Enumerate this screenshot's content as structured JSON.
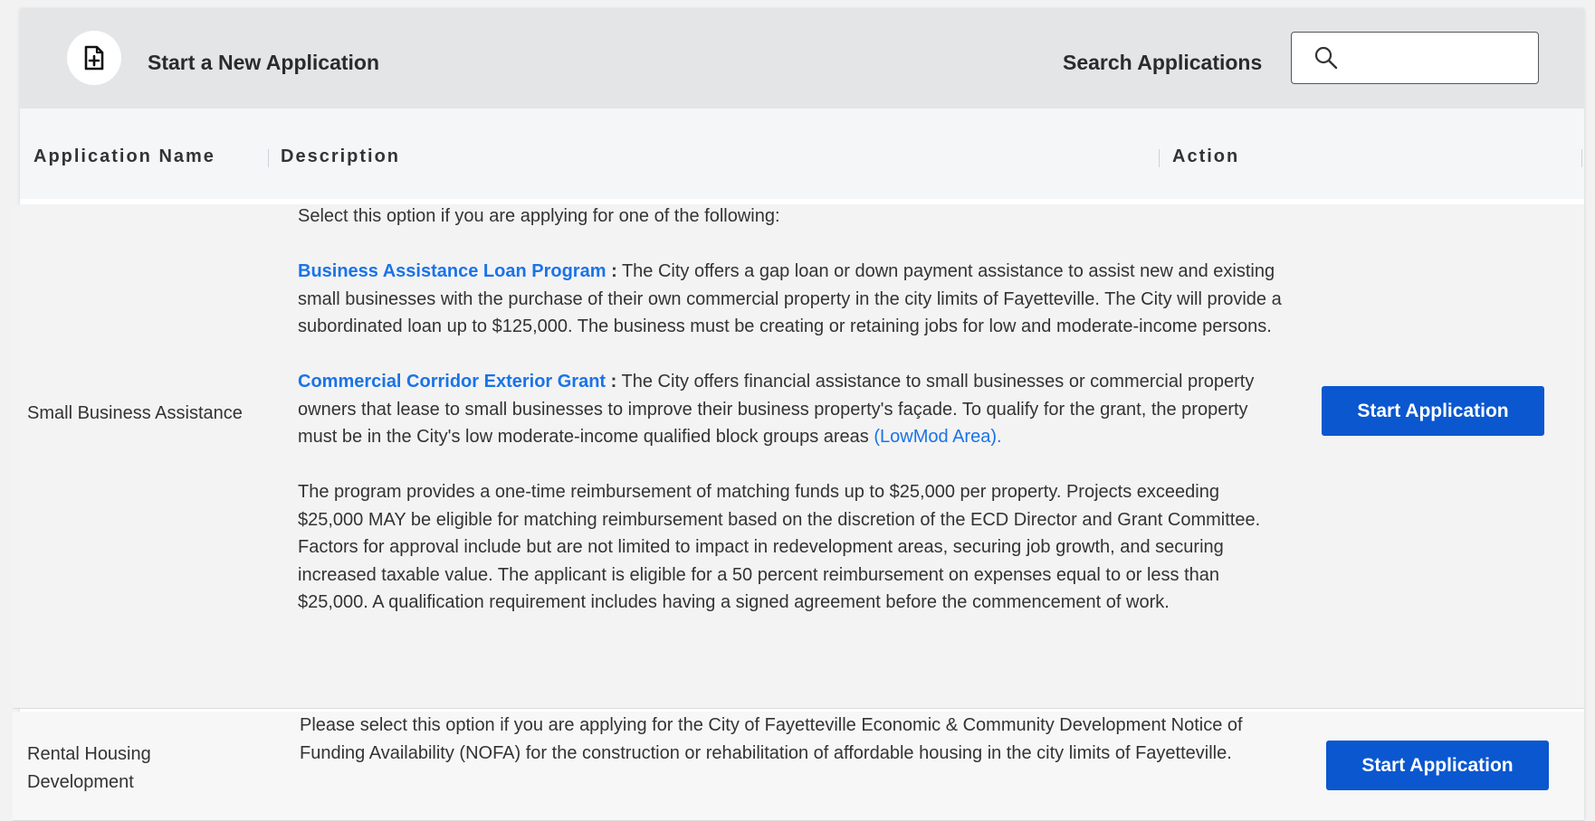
{
  "header": {
    "new_application_label": "Start a New Application",
    "search_label": "Search Applications",
    "search_placeholder": ""
  },
  "table": {
    "columns": [
      "Application Name",
      "Description",
      "Action"
    ],
    "rows": [
      {
        "name": "Small Business Assistance",
        "intro": "Select this option if you are applying for one of the following:",
        "program1_title": "Business Assistance Loan Program",
        "program1_colon": ":",
        "program1_text": "The City offers a gap loan or down payment assistance to assist new and existing small businesses with the purchase of their own commercial property in the city limits of Fayetteville. The City will provide a subordinated loan up to $125,000. The business must be creating or retaining jobs for low and moderate-income persons.",
        "program2_title": "Commercial Corridor Exterior Grant",
        "program2_colon": ":",
        "program2_text": "The City offers financial assistance to small businesses or commercial property owners that lease to small businesses to improve their business property's façade. To qualify for the grant, the property must be in the City's low moderate-income qualified block groups areas",
        "program2_link": "(LowMod Area).",
        "program2_details": "The program provides a one-time reimbursement of matching funds up to $25,000 per property. Projects exceeding $25,000 MAY be eligible for matching reimbursement based on the discretion of the ECD Director and Grant Committee. Factors for approval include but are not limited to impact in redevelopment areas, securing job growth, and securing increased taxable value. The applicant is eligible for a 50 percent reimbursement on expenses equal to or less than $25,000. A qualification requirement includes having a signed agreement before the commencement of work.",
        "action_label": "Start Application"
      },
      {
        "name_line1": "Rental Housing",
        "name_line2": "Development",
        "description": "Please select this option if you are applying for the City of Fayetteville Economic & Community Development Notice of Funding Availability (NOFA) for the construction or rehabilitation of affordable housing in the city limits of Fayetteville.",
        "action_label": "Start Application"
      }
    ]
  },
  "colors": {
    "primary_button": "#0a57d0",
    "link": "#1a73e8",
    "header_bar": "#e4e5e7"
  },
  "icons": {
    "new_application": "file-plus-icon",
    "search": "search-icon"
  }
}
